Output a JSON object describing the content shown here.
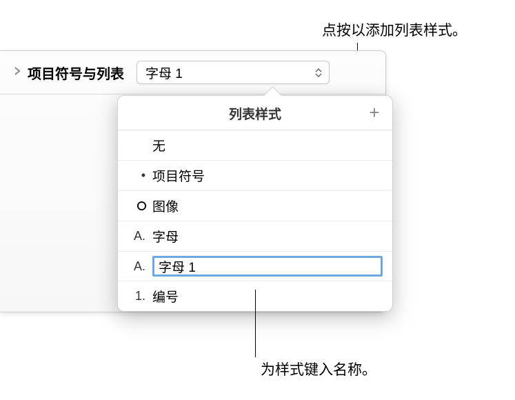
{
  "callouts": {
    "top": "点按以添加列表样式。",
    "bottom": "为样式键入名称。"
  },
  "panel": {
    "header_label": "项目符号与列表",
    "dropdown_value": "字母 1"
  },
  "popover": {
    "title": "列表样式",
    "add_label": "+",
    "items": [
      {
        "marker": "",
        "label": "无",
        "type": "none"
      },
      {
        "marker": "•",
        "label": "项目符号",
        "type": "bullet"
      },
      {
        "marker": "circle",
        "label": "图像",
        "type": "image"
      },
      {
        "marker": "A.",
        "label": "字母",
        "type": "letter"
      },
      {
        "marker": "A.",
        "label": "字母 1",
        "type": "letter",
        "editing": true
      },
      {
        "marker": "1.",
        "label": "编号",
        "type": "number"
      }
    ]
  }
}
